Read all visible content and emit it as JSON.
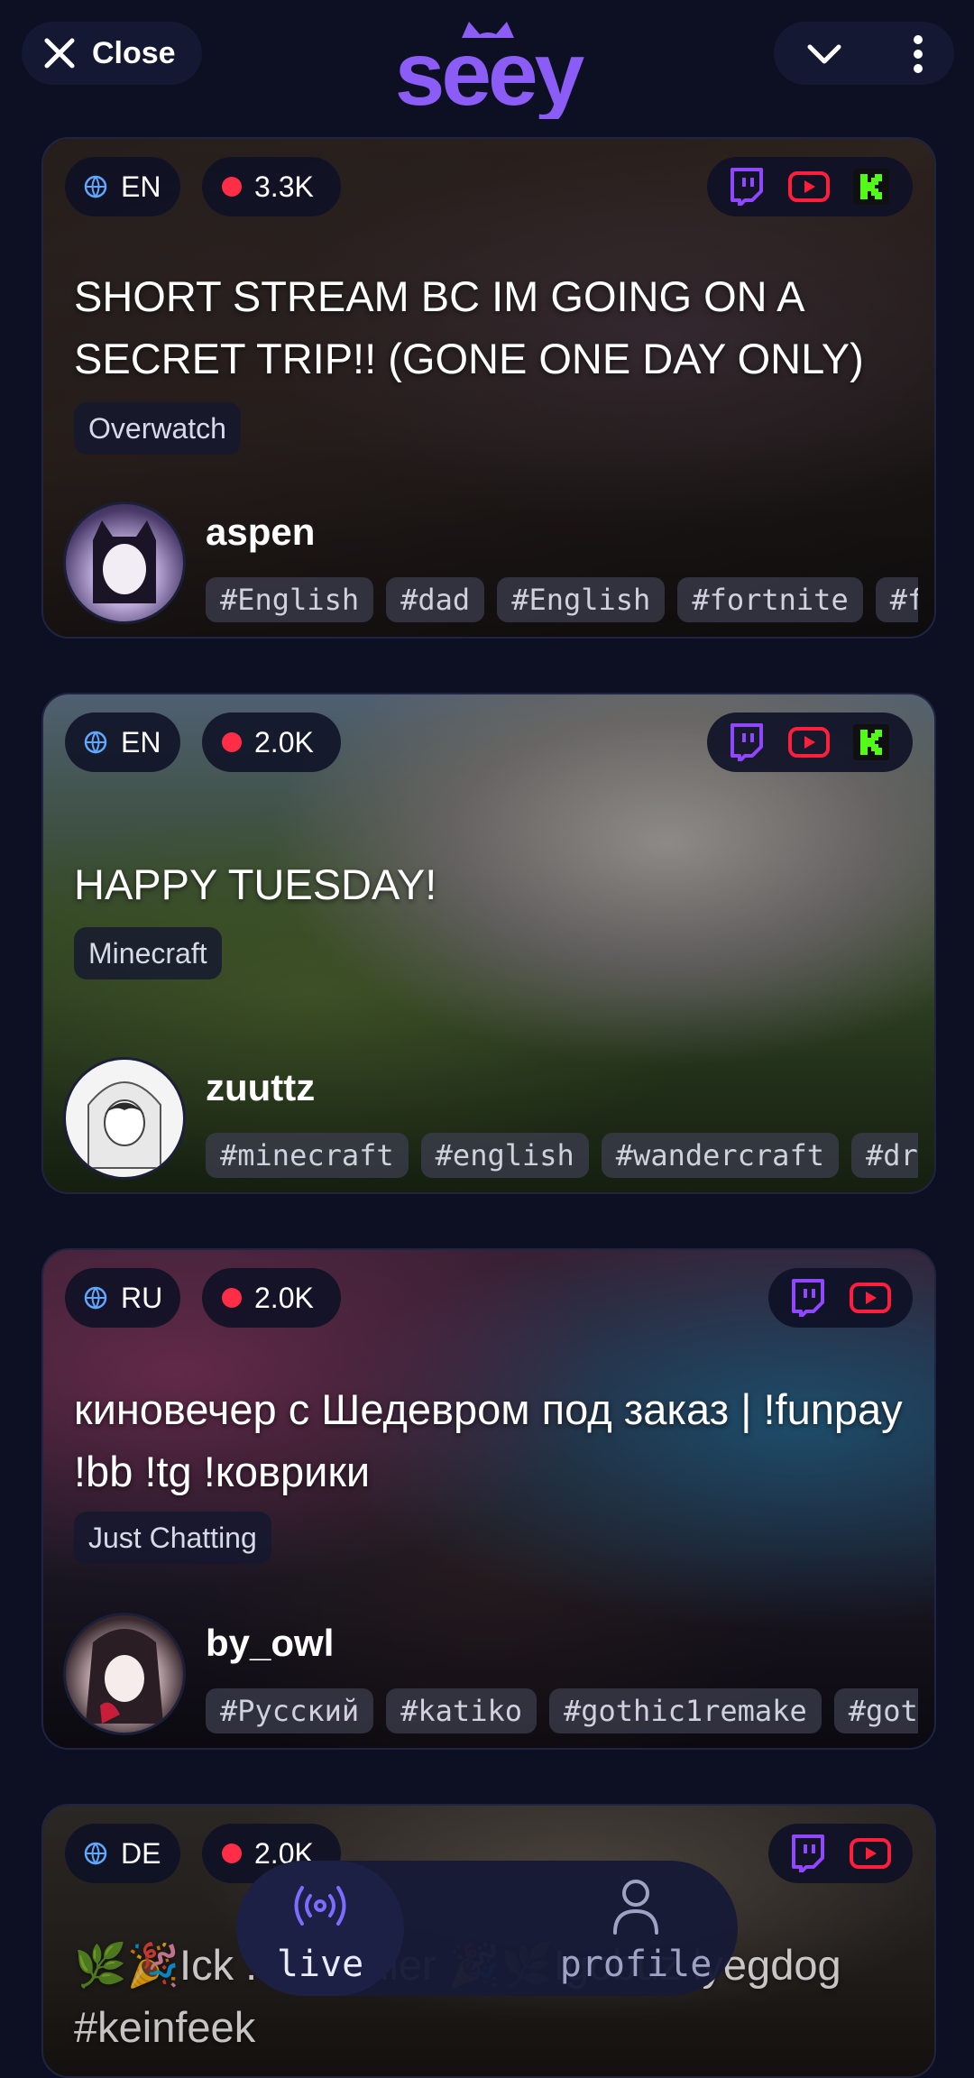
{
  "header": {
    "close_label": "Close",
    "logo_text": "seey"
  },
  "streams": [
    {
      "language": "EN",
      "viewers": "3.3K",
      "platforms": [
        "twitch",
        "youtube",
        "kick"
      ],
      "title": "SHORT STREAM BC IM GOING ON A SECRET TRIP!! (GONE ONE DAY ONLY)",
      "category": "Overwatch",
      "streamer": "aspen",
      "tags": [
        "#English",
        "#dad",
        "#English",
        "#fortnite",
        "#fp"
      ]
    },
    {
      "language": "EN",
      "viewers": "2.0K",
      "platforms": [
        "twitch",
        "youtube",
        "kick"
      ],
      "title": "HAPPY TUESDAY!",
      "category": "Minecraft",
      "streamer": "zuuttz",
      "tags": [
        "#minecraft",
        "#english",
        "#wandercraft",
        "#dro"
      ]
    },
    {
      "language": "RU",
      "viewers": "2.0K",
      "platforms": [
        "twitch",
        "youtube"
      ],
      "title": "киновечер с Шедевром под заказ | !funpay !bb !tg !коврики",
      "category": "Just Chatting",
      "streamer": "by_owl",
      "tags": [
        "#Русский",
        "#katiko",
        "#gothic1remake",
        "#goth"
      ]
    },
    {
      "language": "DE",
      "viewers": "2.0K",
      "platforms": [
        "twitch",
        "youtube"
      ],
      "title": "🌿🎉Ick ... rrspüler 🎉🌿Igobuz lyegdog #keinfeek"
    }
  ],
  "bottom_nav": {
    "live_label": "live",
    "profile_label": "profile",
    "active": "live"
  },
  "colors": {
    "background": "#0d1022",
    "accent": "#8b5cf6",
    "twitch": "#9146ff",
    "youtube": "#ff1f3d",
    "kick": "#53fc18",
    "live_dot": "#ff2d45"
  }
}
